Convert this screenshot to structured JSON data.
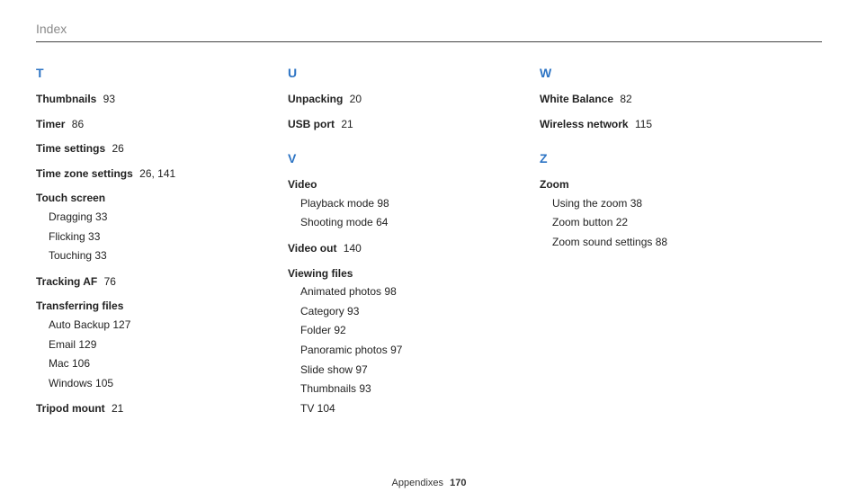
{
  "header": {
    "title": "Index"
  },
  "footer": {
    "section": "Appendixes",
    "page": "170"
  },
  "col1": [
    {
      "letter": "T",
      "entries": [
        {
          "term": "Thumbnails",
          "pages": "93"
        },
        {
          "term": "Timer",
          "pages": "86"
        },
        {
          "term": "Time settings",
          "pages": "26"
        },
        {
          "term": "Time zone settings",
          "pages": "26,  141"
        },
        {
          "term": "Touch screen",
          "subs": [
            {
              "label": "Dragging",
              "page": "33"
            },
            {
              "label": "Flicking",
              "page": "33"
            },
            {
              "label": "Touching",
              "page": "33"
            }
          ]
        },
        {
          "term": "Tracking AF",
          "pages": "76"
        },
        {
          "term": "Transferring files",
          "subs": [
            {
              "label": "Auto Backup",
              "page": "127"
            },
            {
              "label": "Email",
              "page": "129"
            },
            {
              "label": "Mac",
              "page": "106"
            },
            {
              "label": "Windows",
              "page": "105"
            }
          ]
        },
        {
          "term": "Tripod mount",
          "pages": "21"
        }
      ]
    }
  ],
  "col2": [
    {
      "letter": "U",
      "entries": [
        {
          "term": "Unpacking",
          "pages": "20"
        },
        {
          "term": "USB port",
          "pages": "21"
        }
      ]
    },
    {
      "letter": "V",
      "entries": [
        {
          "term": "Video",
          "subs": [
            {
              "label": "Playback mode",
              "page": "98"
            },
            {
              "label": "Shooting mode",
              "page": "64"
            }
          ]
        },
        {
          "term": "Video out",
          "pages": "140"
        },
        {
          "term": "Viewing files",
          "subs": [
            {
              "label": "Animated photos",
              "page": "98"
            },
            {
              "label": "Category",
              "page": "93"
            },
            {
              "label": "Folder",
              "page": "92"
            },
            {
              "label": "Panoramic photos",
              "page": "97"
            },
            {
              "label": "Slide show",
              "page": "97"
            },
            {
              "label": "Thumbnails",
              "page": "93"
            },
            {
              "label": "TV",
              "page": "104"
            }
          ]
        }
      ]
    }
  ],
  "col3": [
    {
      "letter": "W",
      "entries": [
        {
          "term": "White Balance",
          "pages": "82"
        },
        {
          "term": "Wireless network",
          "pages": "115"
        }
      ]
    },
    {
      "letter": "Z",
      "entries": [
        {
          "term": "Zoom",
          "subs": [
            {
              "label": "Using the zoom",
              "page": "38"
            },
            {
              "label": "Zoom button",
              "page": "22"
            },
            {
              "label": "Zoom sound settings",
              "page": "88"
            }
          ]
        }
      ]
    }
  ]
}
